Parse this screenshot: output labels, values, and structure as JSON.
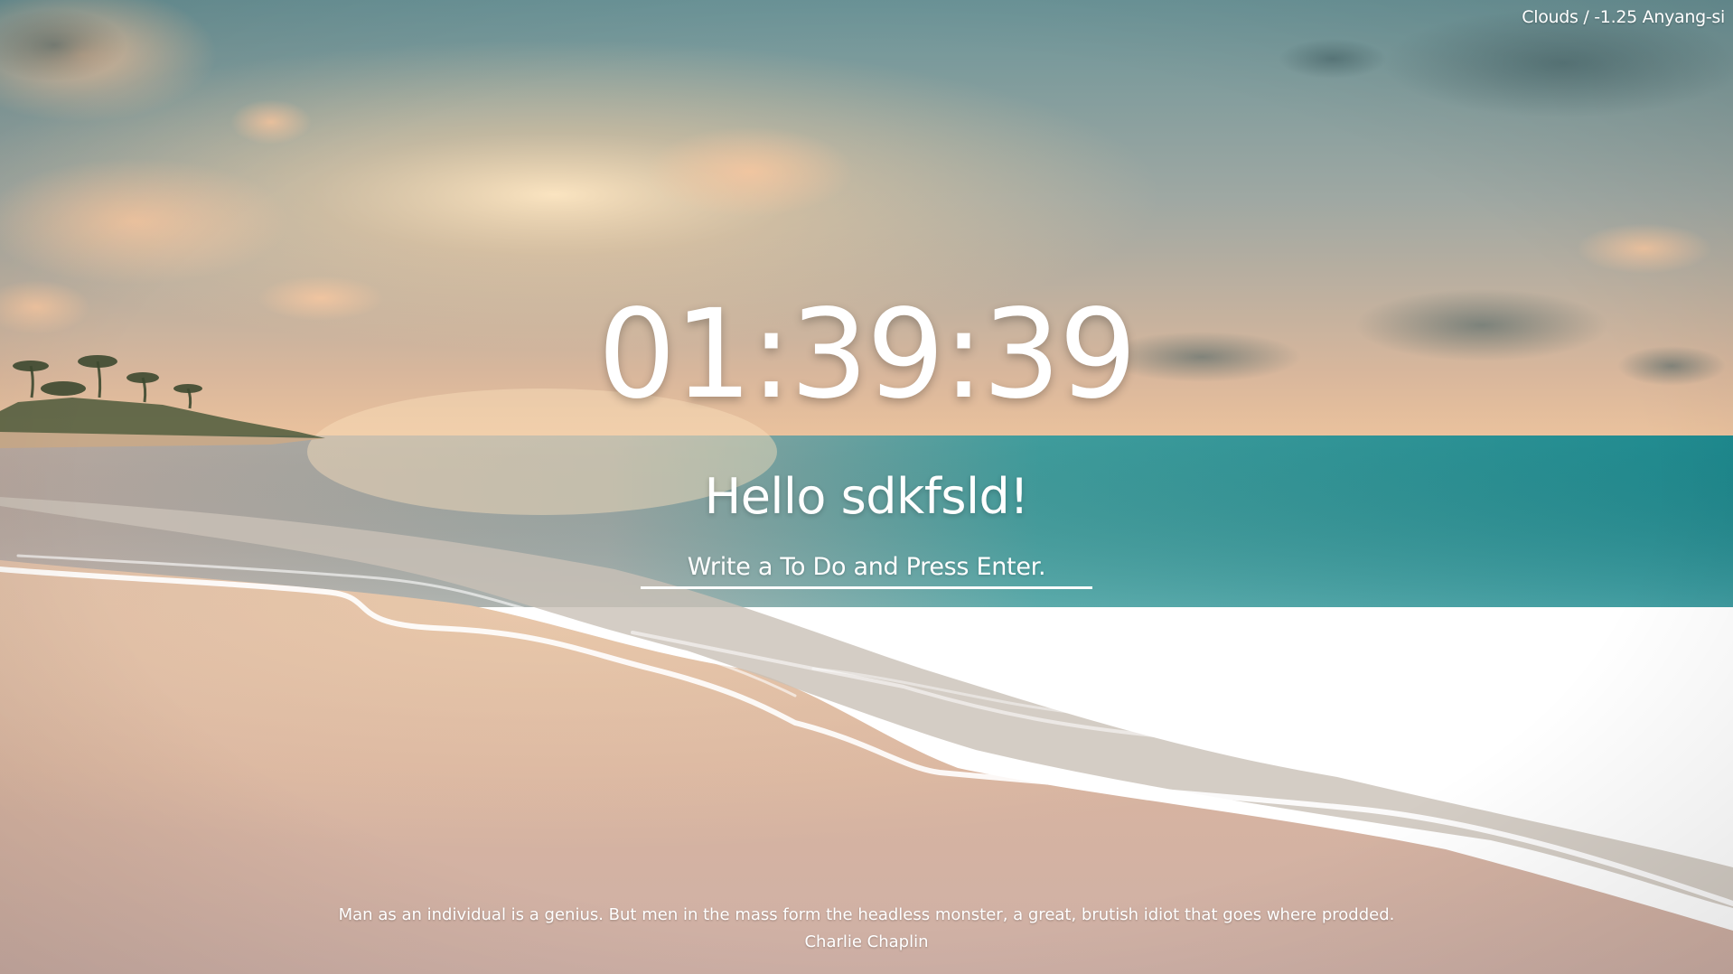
{
  "weather": {
    "text": "Clouds / -1.25 Anyang-si"
  },
  "clock": {
    "time": "01:39:39"
  },
  "greeting": {
    "text": "Hello sdkfsld!"
  },
  "todo": {
    "placeholder": "Write a To Do and Press Enter.",
    "value": ""
  },
  "quote": {
    "text": "Man as an individual is a genius. But men in the mass form the headless monster, a great, brutish idiot that goes where prodded.",
    "author": "Charlie Chaplin"
  },
  "colors": {
    "text": "#ffffff",
    "sky_top": "#6f9aa0",
    "sunset": "#f2c49a",
    "sea": "#2f8f90",
    "sand": "#d9b8a3"
  },
  "background": {
    "icon": "beach-sunset-photo"
  }
}
